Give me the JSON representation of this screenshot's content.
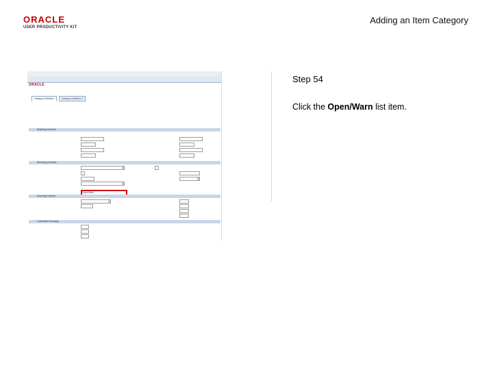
{
  "header": {
    "logo_oracle": "ORACLE",
    "logo_upk": "USER PRODUCTIVITY KIT",
    "slide_title": "Adding an Item Category"
  },
  "step": {
    "title": "Step 54",
    "instruction_prefix": "Click the ",
    "instruction_target": "Open/Warn",
    "instruction_suffix": " list item."
  },
  "screenshot": {
    "logo": "ORACLE",
    "tabs": [
      "Category Definition",
      "Category Definition 2"
    ],
    "sections": [
      "Matching Controls",
      "Receiving Controls",
      "Sourcing Controls",
      "Cumulative Sourcing"
    ],
    "highlight_item": "Open/Warn",
    "colors": {
      "highlight": "#d40000",
      "nav": "#dfe7f2",
      "section": "#c9d6e8"
    }
  }
}
